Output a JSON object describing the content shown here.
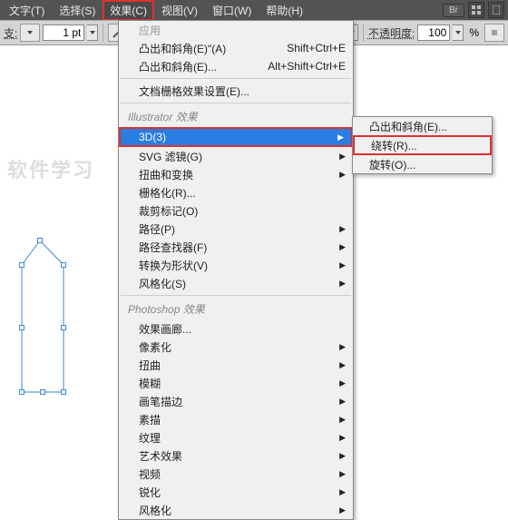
{
  "menubar": {
    "items": [
      "文字(T)",
      "选择(S)",
      "效果(C)",
      "视图(V)",
      "窗口(W)",
      "帮助(H)"
    ],
    "highlighted_index": 2,
    "br": "Br"
  },
  "toolbar": {
    "label_left": "支:",
    "stroke_value": "1 pt",
    "opacity_label": "不透明度:",
    "opacity_value": "100",
    "opacity_unit": "%"
  },
  "menu": {
    "top": [
      {
        "label": "应用",
        "shortcut": "",
        "disabled": true
      },
      {
        "label": "凸出和斜角(E)\"(A)",
        "shortcut": "Shift+Ctrl+E"
      },
      {
        "label": "凸出和斜角(E)...",
        "shortcut": "Alt+Shift+Ctrl+E"
      }
    ],
    "doc_raster": "文档栅格效果设置(E)...",
    "header1": "Illustrator 效果",
    "illustrator": [
      {
        "label": "3D(3)",
        "selected": true,
        "arrow": true
      },
      {
        "label": "SVG 滤镜(G)",
        "arrow": true
      },
      {
        "label": "扭曲和变换",
        "arrow": true
      },
      {
        "label": "栅格化(R)..."
      },
      {
        "label": "裁剪标记(O)"
      },
      {
        "label": "路径(P)",
        "arrow": true
      },
      {
        "label": "路径查找器(F)",
        "arrow": true
      },
      {
        "label": "转换为形状(V)",
        "arrow": true
      },
      {
        "label": "风格化(S)",
        "arrow": true
      }
    ],
    "header2": "Photoshop 效果",
    "photoshop": [
      {
        "label": "效果画廊...",
        "arrow": false
      },
      {
        "label": "像素化",
        "arrow": true
      },
      {
        "label": "扭曲",
        "arrow": true
      },
      {
        "label": "模糊",
        "arrow": true
      },
      {
        "label": "画笔描边",
        "arrow": true
      },
      {
        "label": "素描",
        "arrow": true
      },
      {
        "label": "纹理",
        "arrow": true
      },
      {
        "label": "艺术效果",
        "arrow": true
      },
      {
        "label": "视频",
        "arrow": true
      },
      {
        "label": "锐化",
        "arrow": true
      },
      {
        "label": "风格化",
        "arrow": true
      }
    ]
  },
  "submenu": {
    "items": [
      "凸出和斜角(E)...",
      "绕转(R)...",
      "旋转(O)..."
    ],
    "highlighted_index": 1
  },
  "watermark": "软件学习"
}
